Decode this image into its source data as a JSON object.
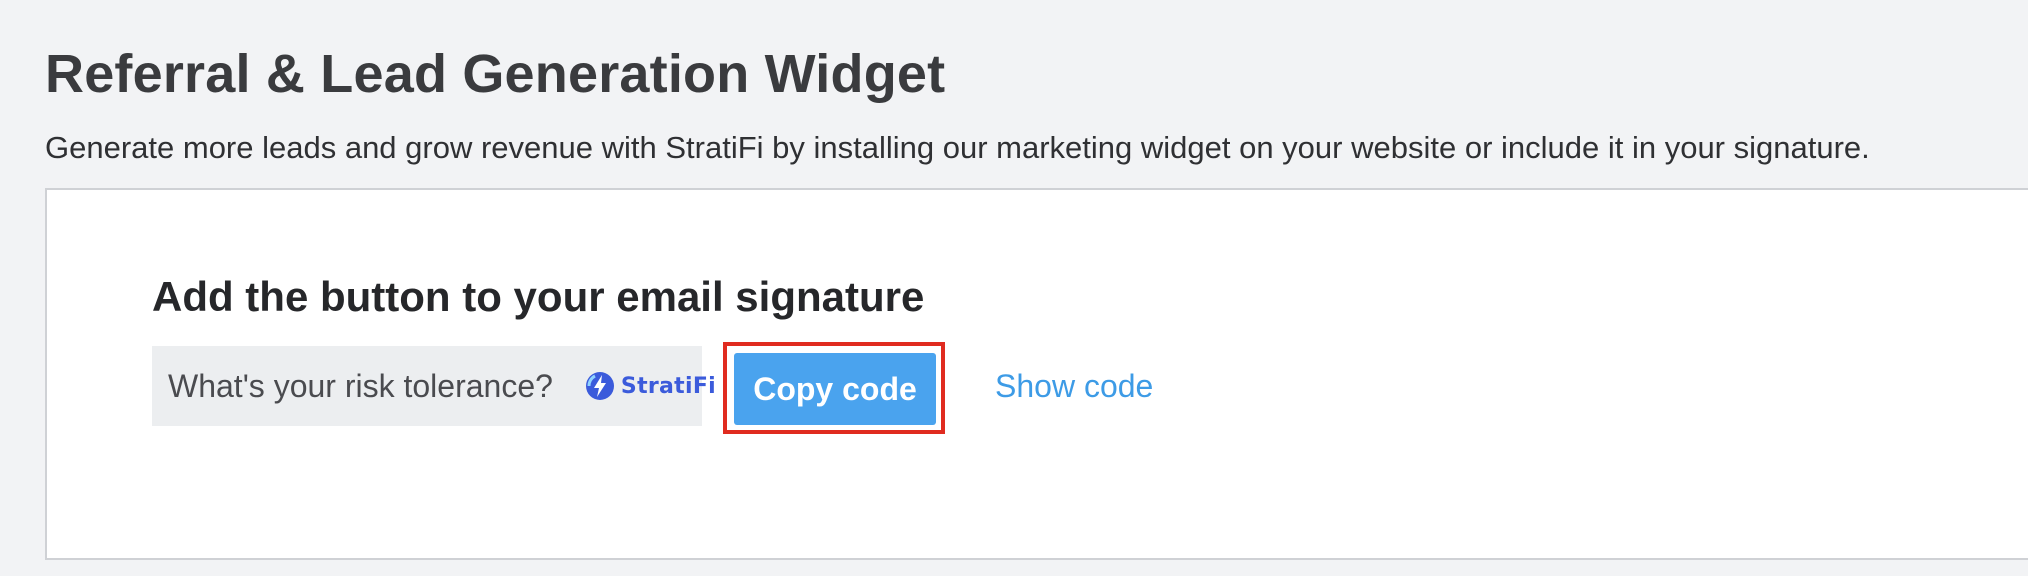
{
  "page": {
    "title": "Referral & Lead Generation Widget",
    "subtitle": "Generate more leads and grow revenue with StratiFi by installing our marketing widget on your website or include it in your signature."
  },
  "signature_section": {
    "title": "Add the button to your email signature",
    "widget_preview": {
      "question": "What's your risk tolerance?",
      "logo_text": "StratiFi",
      "logo_icon": "stratifi-logo-icon",
      "background_color": "#eceef0"
    },
    "copy_button_label": "Copy code",
    "show_code_label": "Show code"
  },
  "colors": {
    "accent": "#4aa3ee",
    "link": "#3d9be6",
    "highlight_border": "#e02b20",
    "logo": "#3b5bdb"
  }
}
